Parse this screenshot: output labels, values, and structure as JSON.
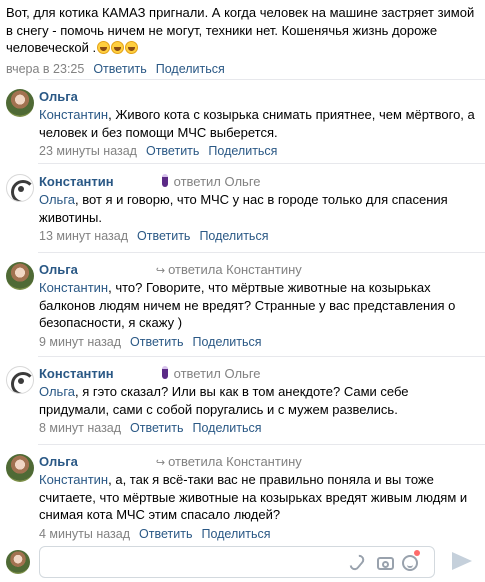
{
  "post": {
    "text": "Вот, для котика КАМАЗ пригнали. А когда человек на машине застряет зимой в снегу - помочь ничем не могут, техники нет. Кошенячья жизнь дороже человеческой .",
    "emoji": [
      "laughing-face",
      "laughing-face",
      "laughing-face"
    ],
    "time": "вчера в 23:25",
    "reply_label": "Ответить",
    "share_label": "Поделиться"
  },
  "comments": [
    {
      "author": "Ольга",
      "avatar": "olga-photo",
      "reply_to": "",
      "mention": "Константин",
      "text": ", Живого кота с козырька снимать приятнее, чем мёртвого, а человек и без помощи МЧС выберется.",
      "time": "23 минуты назад",
      "reply_label": "Ответить",
      "share_label": "Поделиться"
    },
    {
      "author": "Константин",
      "avatar": "konstantin-logo",
      "reply_to": "ответил Ольге",
      "mention": "Ольга",
      "text": ", вот я и говорю, что МЧС у нас в городе только для спасения животины.",
      "time": "13 минут назад",
      "reply_label": "Ответить",
      "share_label": "Поделиться"
    },
    {
      "author": "Ольга",
      "avatar": "olga-photo",
      "reply_to": "ответила Константину",
      "mention": "Константин",
      "text": ", что? Говорите, что мёртвые животные на козырьках балконов людям ничем не вредят? Странные у вас представления о безопасности, я скажу )",
      "time": "9 минут назад",
      "reply_label": "Ответить",
      "share_label": "Поделиться"
    },
    {
      "author": "Константин",
      "avatar": "konstantin-logo",
      "reply_to": "ответил Ольге",
      "mention": "Ольга",
      "text": ", я гэто сказал? Или вы как в том анекдоте? Сами себе придумали, сами с собой поругались и с мужем развелись.",
      "time": "8 минут назад",
      "reply_label": "Ответить",
      "share_label": "Поделиться"
    },
    {
      "author": "Ольга",
      "avatar": "olga-photo",
      "reply_to": "ответила Константину",
      "mention": "Константин",
      "text": ", а, так я всё-таки вас не правильно поняла и вы тоже считаете, что мёртвые животные на козырьках вредят живым людям и снимая кота МЧС этим спасало людей?",
      "time": "4 минуты назад",
      "reply_label": "Ответить",
      "share_label": "Поделиться"
    }
  ],
  "composer": {
    "placeholder": "",
    "icons": [
      "paperclip-icon",
      "camera-icon",
      "smile-icon",
      "send-icon"
    ]
  },
  "colors": {
    "link": "#2a5885",
    "meta": "#828282",
    "divider": "#e7e8ec",
    "badge": "#5b2a86"
  }
}
